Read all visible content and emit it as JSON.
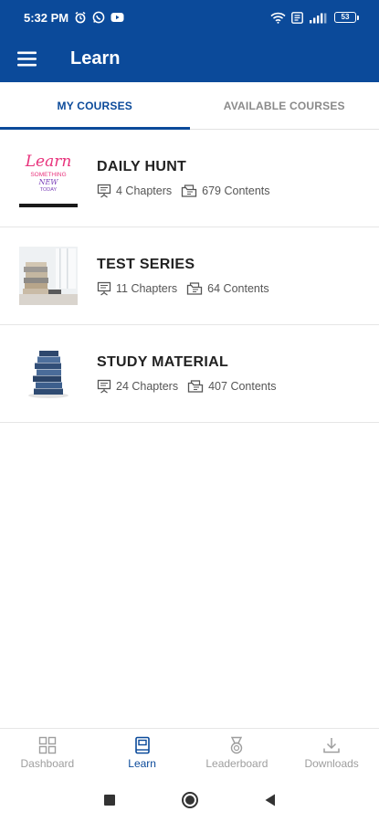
{
  "status_bar": {
    "time": "5:32 PM",
    "battery_level": "53",
    "icons": [
      "alarm-icon",
      "whatsapp-icon",
      "youtube-icon",
      "wifi-icon",
      "volte-icon",
      "signal-icon",
      "battery-icon"
    ]
  },
  "app_bar": {
    "title": "Learn",
    "menu_icon": "hamburger-menu-icon"
  },
  "tabs": [
    {
      "label": "MY COURSES",
      "active": true
    },
    {
      "label": "AVAILABLE COURSES",
      "active": false
    }
  ],
  "courses": [
    {
      "title": "DAILY HUNT",
      "chapters": "4 Chapters",
      "contents": "679 Contents",
      "thumbnail_text": [
        "Learn",
        "SOMETHING",
        "NEW",
        "TODAY"
      ]
    },
    {
      "title": "TEST SERIES",
      "chapters": "11 Chapters",
      "contents": "64 Contents"
    },
    {
      "title": "STUDY MATERIAL",
      "chapters": "24 Chapters",
      "contents": "407 Contents"
    }
  ],
  "bottom_nav": [
    {
      "label": "Dashboard",
      "icon": "dashboard-grid-icon",
      "active": false
    },
    {
      "label": "Learn",
      "icon": "book-icon",
      "active": true
    },
    {
      "label": "Leaderboard",
      "icon": "medal-icon",
      "active": false
    },
    {
      "label": "Downloads",
      "icon": "download-icon",
      "active": false
    }
  ],
  "colors": {
    "brand": "#0b4a9a",
    "inactive": "#9e9e9e",
    "divider": "#e6e6e6"
  }
}
